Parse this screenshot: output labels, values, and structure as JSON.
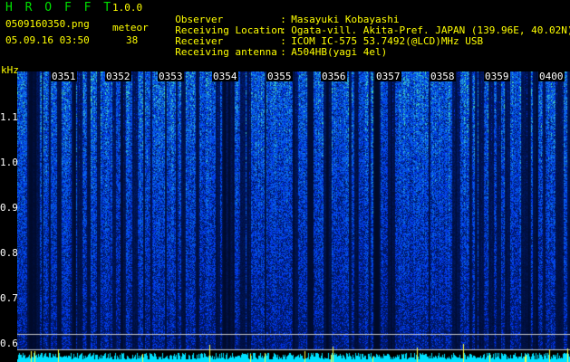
{
  "header": {
    "app_title": "H R O F F T",
    "app_version": "1.0.0",
    "file_name": "0509160350.png",
    "datetime": "05.09.16 03:50",
    "count_label": "meteor",
    "count_value": "38"
  },
  "info": [
    {
      "key": "Observer",
      "value": "Masayuki Kobayashi"
    },
    {
      "key": "Receiving Location",
      "value": "Ogata-vill. Akita-Pref. JAPAN (139.96E, 40.02N)"
    },
    {
      "key": "Receiver",
      "value": "ICOM IC-575 53.7492(@LCD)MHz USB"
    },
    {
      "key": "Receiving antenna",
      "value": "A504HB(yagi 4el)"
    }
  ],
  "axis": {
    "unit": "kHz",
    "y_ticks": [
      "1.1",
      "1.0",
      "0.9",
      "0.8",
      "0.7",
      "0.6"
    ],
    "time_ticks": [
      "0351",
      "0352",
      "0353",
      "0354",
      "0355",
      "0356",
      "0357",
      "0358",
      "0359",
      "0400"
    ]
  },
  "colors": {
    "background": "#000000",
    "header_text": "#ffff00",
    "title_text": "#00e000",
    "grid_line": "#c8c8c8",
    "signal_low": "#001060",
    "signal_mid": "#1e60ff",
    "signal_high": "#40ff80",
    "baseline_bars": "#00e0ff",
    "spike": "#ffff40"
  }
}
